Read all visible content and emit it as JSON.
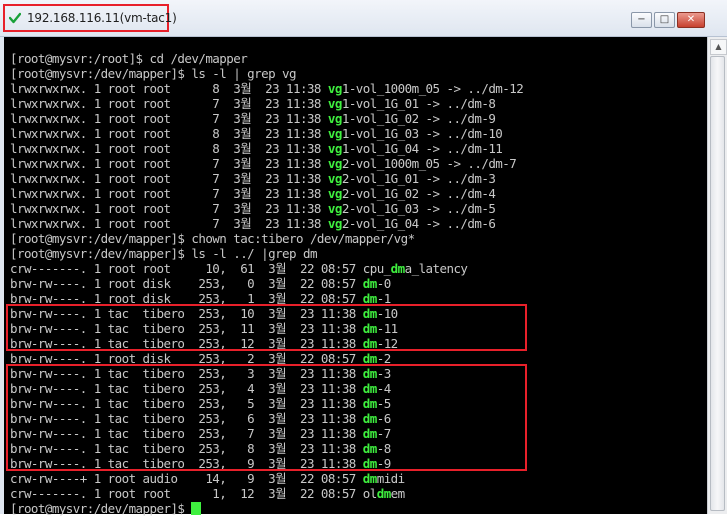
{
  "window": {
    "title": "192.168.116.11(vm-tac1)",
    "buttons": {
      "minimize": "−",
      "maximize": "□",
      "close": "✕"
    }
  },
  "colors": {
    "terminal_bg": "#000000",
    "text": "#c8c8c8",
    "highlight_green": "#3ff03f",
    "annotation_red": "#e8202a"
  },
  "terminal": {
    "lines": [
      {
        "segments": [
          {
            "text": "[root@mysvr:/root]$ cd /dev/mapper",
            "hl": false
          }
        ]
      },
      {
        "segments": [
          {
            "text": "[root@mysvr:/dev/mapper]$ ls -l | grep vg",
            "hl": false
          }
        ]
      },
      {
        "segments": [
          {
            "text": "lrwxrwxrwx. 1 root root      8  3월  23 11:38 ",
            "hl": false
          },
          {
            "text": "vg",
            "hl": true
          },
          {
            "text": "1-vol_1000m_05 -> ../dm-12",
            "hl": false
          }
        ]
      },
      {
        "segments": [
          {
            "text": "lrwxrwxrwx. 1 root root      7  3월  23 11:38 ",
            "hl": false
          },
          {
            "text": "vg",
            "hl": true
          },
          {
            "text": "1-vol_1G_01 -> ../dm-8",
            "hl": false
          }
        ]
      },
      {
        "segments": [
          {
            "text": "lrwxrwxrwx. 1 root root      7  3월  23 11:38 ",
            "hl": false
          },
          {
            "text": "vg",
            "hl": true
          },
          {
            "text": "1-vol_1G_02 -> ../dm-9",
            "hl": false
          }
        ]
      },
      {
        "segments": [
          {
            "text": "lrwxrwxrwx. 1 root root      8  3월  23 11:38 ",
            "hl": false
          },
          {
            "text": "vg",
            "hl": true
          },
          {
            "text": "1-vol_1G_03 -> ../dm-10",
            "hl": false
          }
        ]
      },
      {
        "segments": [
          {
            "text": "lrwxrwxrwx. 1 root root      8  3월  23 11:38 ",
            "hl": false
          },
          {
            "text": "vg",
            "hl": true
          },
          {
            "text": "1-vol_1G_04 -> ../dm-11",
            "hl": false
          }
        ]
      },
      {
        "segments": [
          {
            "text": "lrwxrwxrwx. 1 root root      7  3월  23 11:38 ",
            "hl": false
          },
          {
            "text": "vg",
            "hl": true
          },
          {
            "text": "2-vol_1000m_05 -> ../dm-7",
            "hl": false
          }
        ]
      },
      {
        "segments": [
          {
            "text": "lrwxrwxrwx. 1 root root      7  3월  23 11:38 ",
            "hl": false
          },
          {
            "text": "vg",
            "hl": true
          },
          {
            "text": "2-vol_1G_01 -> ../dm-3",
            "hl": false
          }
        ]
      },
      {
        "segments": [
          {
            "text": "lrwxrwxrwx. 1 root root      7  3월  23 11:38 ",
            "hl": false
          },
          {
            "text": "vg",
            "hl": true
          },
          {
            "text": "2-vol_1G_02 -> ../dm-4",
            "hl": false
          }
        ]
      },
      {
        "segments": [
          {
            "text": "lrwxrwxrwx. 1 root root      7  3월  23 11:38 ",
            "hl": false
          },
          {
            "text": "vg",
            "hl": true
          },
          {
            "text": "2-vol_1G_03 -> ../dm-5",
            "hl": false
          }
        ]
      },
      {
        "segments": [
          {
            "text": "lrwxrwxrwx. 1 root root      7  3월  23 11:38 ",
            "hl": false
          },
          {
            "text": "vg",
            "hl": true
          },
          {
            "text": "2-vol_1G_04 -> ../dm-6",
            "hl": false
          }
        ]
      },
      {
        "segments": [
          {
            "text": "[root@mysvr:/dev/mapper]$ chown tac:tibero /dev/mapper/vg*",
            "hl": false
          }
        ]
      },
      {
        "segments": [
          {
            "text": "[root@mysvr:/dev/mapper]$ ls -l ../ |grep dm",
            "hl": false
          }
        ]
      },
      {
        "segments": [
          {
            "text": "crw-------. 1 root root     10,  61  3월  22 08:57 cpu_",
            "hl": false
          },
          {
            "text": "dm",
            "hl": true
          },
          {
            "text": "a_latency",
            "hl": false
          }
        ]
      },
      {
        "segments": [
          {
            "text": "brw-rw----. 1 root disk    253,   0  3월  22 08:57 ",
            "hl": false
          },
          {
            "text": "dm",
            "hl": true
          },
          {
            "text": "-0",
            "hl": false
          }
        ]
      },
      {
        "segments": [
          {
            "text": "brw-rw----. 1 root disk    253,   1  3월  22 08:57 ",
            "hl": false
          },
          {
            "text": "dm",
            "hl": true
          },
          {
            "text": "-1",
            "hl": false
          }
        ]
      },
      {
        "segments": [
          {
            "text": "brw-rw----. 1 tac  tibero  253,  10  3월  23 11:38 ",
            "hl": false
          },
          {
            "text": "dm",
            "hl": true
          },
          {
            "text": "-10",
            "hl": false
          }
        ]
      },
      {
        "segments": [
          {
            "text": "brw-rw----. 1 tac  tibero  253,  11  3월  23 11:38 ",
            "hl": false
          },
          {
            "text": "dm",
            "hl": true
          },
          {
            "text": "-11",
            "hl": false
          }
        ]
      },
      {
        "segments": [
          {
            "text": "brw-rw----. 1 tac  tibero  253,  12  3월  23 11:38 ",
            "hl": false
          },
          {
            "text": "dm",
            "hl": true
          },
          {
            "text": "-12",
            "hl": false
          }
        ]
      },
      {
        "segments": [
          {
            "text": "brw-rw----. 1 root disk    253,   2  3월  22 08:57 ",
            "hl": false
          },
          {
            "text": "dm",
            "hl": true
          },
          {
            "text": "-2",
            "hl": false
          }
        ]
      },
      {
        "segments": [
          {
            "text": "brw-rw----. 1 tac  tibero  253,   3  3월  23 11:38 ",
            "hl": false
          },
          {
            "text": "dm",
            "hl": true
          },
          {
            "text": "-3",
            "hl": false
          }
        ]
      },
      {
        "segments": [
          {
            "text": "brw-rw----. 1 tac  tibero  253,   4  3월  23 11:38 ",
            "hl": false
          },
          {
            "text": "dm",
            "hl": true
          },
          {
            "text": "-4",
            "hl": false
          }
        ]
      },
      {
        "segments": [
          {
            "text": "brw-rw----. 1 tac  tibero  253,   5  3월  23 11:38 ",
            "hl": false
          },
          {
            "text": "dm",
            "hl": true
          },
          {
            "text": "-5",
            "hl": false
          }
        ]
      },
      {
        "segments": [
          {
            "text": "brw-rw----. 1 tac  tibero  253,   6  3월  23 11:38 ",
            "hl": false
          },
          {
            "text": "dm",
            "hl": true
          },
          {
            "text": "-6",
            "hl": false
          }
        ]
      },
      {
        "segments": [
          {
            "text": "brw-rw----. 1 tac  tibero  253,   7  3월  23 11:38 ",
            "hl": false
          },
          {
            "text": "dm",
            "hl": true
          },
          {
            "text": "-7",
            "hl": false
          }
        ]
      },
      {
        "segments": [
          {
            "text": "brw-rw----. 1 tac  tibero  253,   8  3월  23 11:38 ",
            "hl": false
          },
          {
            "text": "dm",
            "hl": true
          },
          {
            "text": "-8",
            "hl": false
          }
        ]
      },
      {
        "segments": [
          {
            "text": "brw-rw----. 1 tac  tibero  253,   9  3월  23 11:38 ",
            "hl": false
          },
          {
            "text": "dm",
            "hl": true
          },
          {
            "text": "-9",
            "hl": false
          }
        ]
      },
      {
        "segments": [
          {
            "text": "crw-rw----+ 1 root audio    14,   9  3월  22 08:57 ",
            "hl": false
          },
          {
            "text": "dm",
            "hl": true
          },
          {
            "text": "midi",
            "hl": false
          }
        ]
      },
      {
        "segments": [
          {
            "text": "crw-------. 1 root root      1,  12  3월  22 08:57 ol",
            "hl": false
          },
          {
            "text": "dm",
            "hl": true
          },
          {
            "text": "em",
            "hl": false
          }
        ]
      },
      {
        "segments": [
          {
            "text": "[root@mysvr:/dev/mapper]$ ",
            "hl": false
          }
        ],
        "cursor": true
      }
    ]
  }
}
